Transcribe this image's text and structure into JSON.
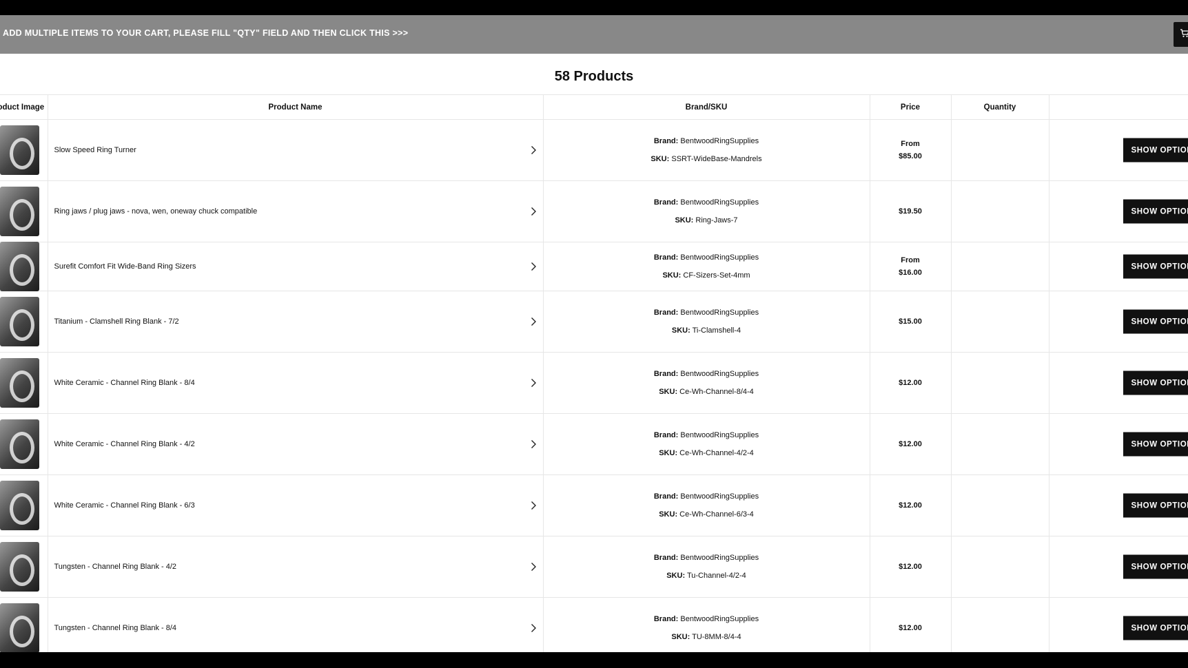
{
  "bulk_bar": {
    "text": "ADD MULTIPLE ITEMS TO YOUR CART, PLEASE FILL \"QTY\" FIELD AND THEN CLICK THIS >>>",
    "cart_icon": "cart-icon"
  },
  "product_count": "58 Products",
  "table": {
    "headers": {
      "image": "Product Image",
      "name": "Product Name",
      "brand_sku": "Brand/SKU",
      "price": "Price",
      "quantity": "Quantity"
    },
    "brand_label": "Brand:",
    "sku_label": "SKU:",
    "button_label": "SHOW OPTIONS",
    "rows": [
      {
        "name": "Slow Speed Ring Turner",
        "brand": "BentwoodRingSupplies",
        "sku": "SSRT-WideBase-Mandrels",
        "price_from": "From",
        "price": "$85.00"
      },
      {
        "name": "Ring jaws / plug jaws - nova, wen, oneway chuck compatible",
        "brand": "BentwoodRingSupplies",
        "sku": "Ring-Jaws-7",
        "price_from": "",
        "price": "$19.50"
      },
      {
        "name": "Surefit Comfort Fit Wide-Band Ring Sizers",
        "brand": "BentwoodRingSupplies",
        "sku": "CF-Sizers-Set-4mm",
        "price_from": "From",
        "price": "$16.00"
      },
      {
        "name": "Titanium - Clamshell Ring Blank - 7/2",
        "brand": "BentwoodRingSupplies",
        "sku": "Ti-Clamshell-4",
        "price_from": "",
        "price": "$15.00"
      },
      {
        "name": "White Ceramic - Channel Ring Blank - 8/4",
        "brand": "BentwoodRingSupplies",
        "sku": "Ce-Wh-Channel-8/4-4",
        "price_from": "",
        "price": "$12.00"
      },
      {
        "name": "White Ceramic - Channel Ring Blank - 4/2",
        "brand": "BentwoodRingSupplies",
        "sku": "Ce-Wh-Channel-4/2-4",
        "price_from": "",
        "price": "$12.00"
      },
      {
        "name": "White Ceramic - Channel Ring Blank - 6/3",
        "brand": "BentwoodRingSupplies",
        "sku": "Ce-Wh-Channel-6/3-4",
        "price_from": "",
        "price": "$12.00"
      },
      {
        "name": "Tungsten - Channel Ring Blank - 4/2",
        "brand": "BentwoodRingSupplies",
        "sku": "Tu-Channel-4/2-4",
        "price_from": "",
        "price": "$12.00"
      },
      {
        "name": "Tungsten - Channel Ring Blank - 8/4",
        "brand": "BentwoodRingSupplies",
        "sku": "TU-8MM-8/4-4",
        "price_from": "",
        "price": "$12.00"
      }
    ]
  }
}
